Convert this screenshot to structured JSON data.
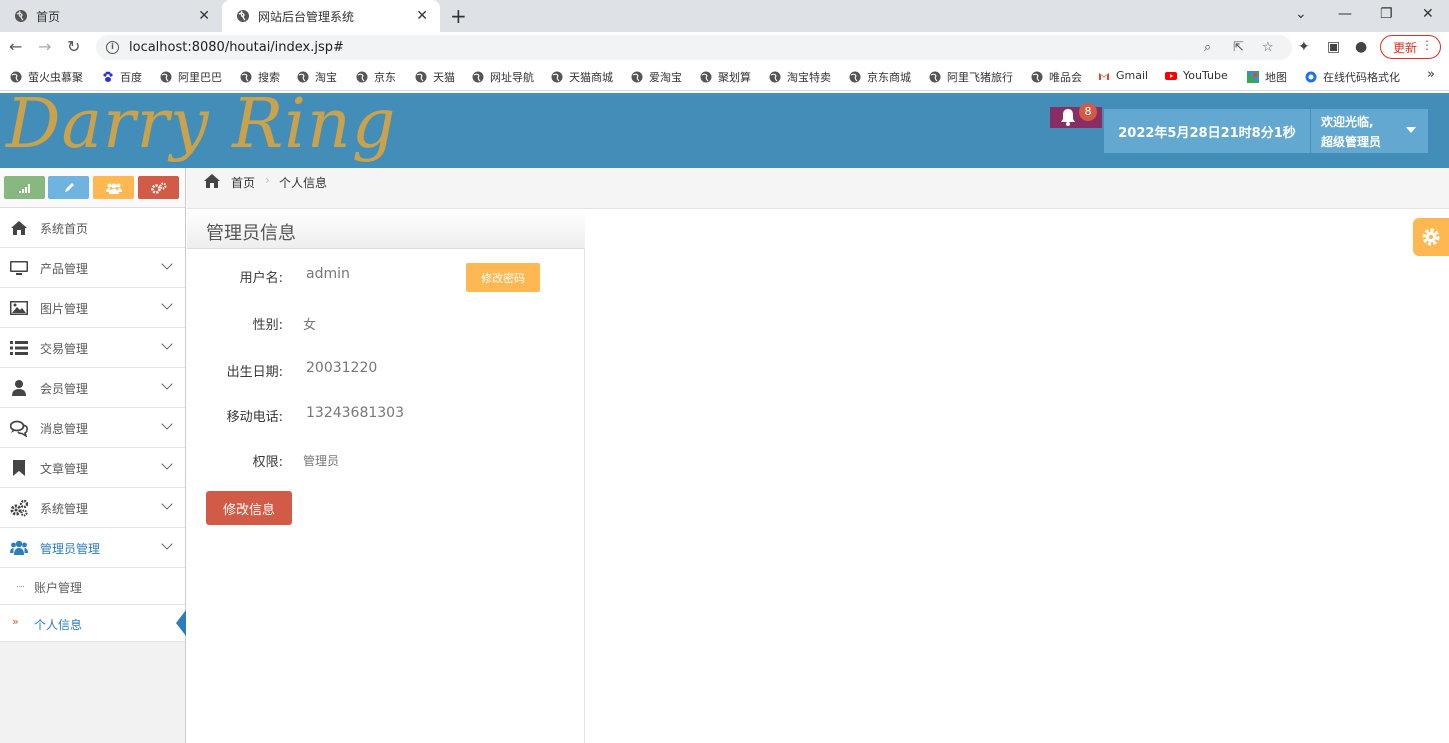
{
  "browser": {
    "tabs": [
      {
        "title": "首页",
        "active": false
      },
      {
        "title": "网站后台管理系统",
        "active": true
      }
    ],
    "url": "localhost:8080/houtai/index.jsp#",
    "update_label": "更新",
    "bookmarks": [
      "萤火虫慕聚",
      "百度",
      "阿里巴巴",
      "搜索",
      "淘宝",
      "京东",
      "天猫",
      "网址导航",
      "天猫商城",
      "爱淘宝",
      "聚划算",
      "淘宝特卖",
      "京东商城",
      "阿里飞猪旅行",
      "唯品会",
      "Gmail",
      "YouTube",
      "地图",
      "在线代码格式化"
    ]
  },
  "header": {
    "logo_text": "Darry Ring",
    "notification_count": "8",
    "datetime": "2022年5月28日21时8分1秒",
    "welcome_line1": "欢迎光临,",
    "welcome_line2": "超级管理员"
  },
  "sidebar": {
    "items": [
      {
        "label": "系统首页",
        "icon": "home-icon"
      },
      {
        "label": "产品管理",
        "icon": "desktop-icon"
      },
      {
        "label": "图片管理",
        "icon": "picture-icon"
      },
      {
        "label": "交易管理",
        "icon": "list-icon"
      },
      {
        "label": "会员管理",
        "icon": "user-icon"
      },
      {
        "label": "消息管理",
        "icon": "comments-icon"
      },
      {
        "label": "文章管理",
        "icon": "bookmark-icon"
      },
      {
        "label": "系统管理",
        "icon": "cogs-icon"
      },
      {
        "label": "管理员管理",
        "icon": "group-icon"
      }
    ],
    "subitems": [
      {
        "label": "账户管理"
      },
      {
        "label": "个人信息"
      }
    ]
  },
  "breadcrumb": {
    "home": "首页",
    "current": "个人信息"
  },
  "panel": {
    "title": "管理员信息",
    "fields": [
      {
        "label": "用户名:",
        "value": "admin"
      },
      {
        "label": "性别:",
        "value": "女"
      },
      {
        "label": "出生日期:",
        "value": "20031220"
      },
      {
        "label": "移动电话:",
        "value": "13243681303"
      },
      {
        "label": "权限:",
        "value": "管理员"
      }
    ],
    "change_password_label": "修改密码",
    "edit_label": "修改信息"
  },
  "colors": {
    "header_bg": "#438eb9",
    "accent_blue": "#2b7dbc",
    "btn_orange": "#ffb752",
    "btn_red": "#d15b47",
    "btn_green": "#87b87f",
    "btn_lightblue": "#6fb3e0",
    "logo_gold": "#c9a24b"
  }
}
